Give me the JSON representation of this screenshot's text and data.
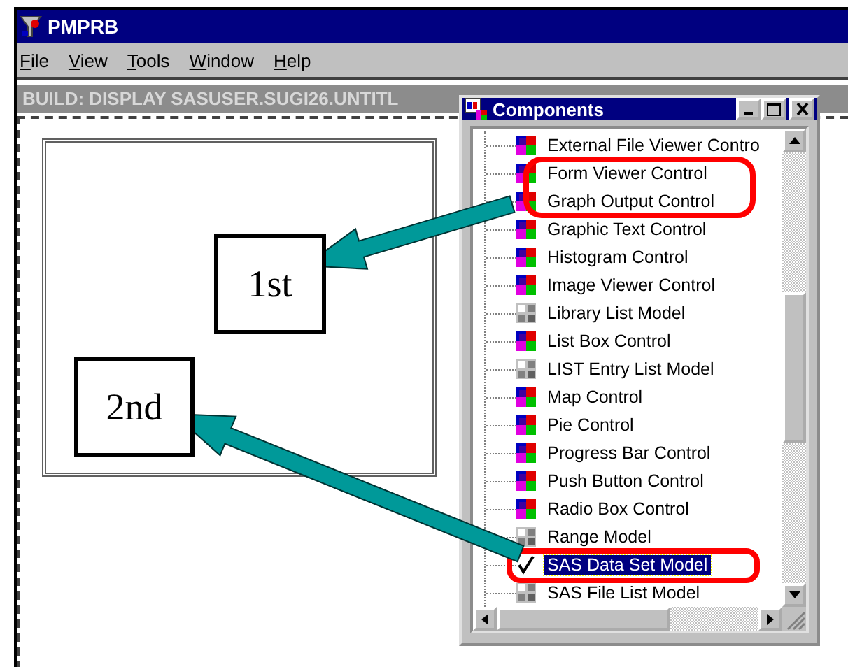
{
  "window": {
    "title": "PMPRB"
  },
  "menu": [
    {
      "label": "File"
    },
    {
      "label": "View"
    },
    {
      "label": "Tools"
    },
    {
      "label": "Window"
    },
    {
      "label": "Help"
    }
  ],
  "build_window": {
    "title": "BUILD: DISPLAY SASUSER.SUGI26.UNTITL"
  },
  "components": {
    "title": "Components",
    "items": [
      {
        "label": "External File Viewer Contro",
        "kind": "control",
        "selected": false
      },
      {
        "label": "Form Viewer Control",
        "kind": "control",
        "selected": false
      },
      {
        "label": "Graph Output Control",
        "kind": "control",
        "selected": false
      },
      {
        "label": "Graphic Text Control",
        "kind": "control",
        "selected": false
      },
      {
        "label": "Histogram Control",
        "kind": "control",
        "selected": false
      },
      {
        "label": "Image Viewer Control",
        "kind": "control",
        "selected": false
      },
      {
        "label": "Library List Model",
        "kind": "model",
        "selected": false
      },
      {
        "label": "List Box Control",
        "kind": "control",
        "selected": false
      },
      {
        "label": "LIST Entry List Model",
        "kind": "model",
        "selected": false
      },
      {
        "label": "Map Control",
        "kind": "control",
        "selected": false
      },
      {
        "label": "Pie Control",
        "kind": "control",
        "selected": false
      },
      {
        "label": "Progress Bar Control",
        "kind": "control",
        "selected": false
      },
      {
        "label": "Push Button Control",
        "kind": "control",
        "selected": false
      },
      {
        "label": "Radio Box Control",
        "kind": "control",
        "selected": false
      },
      {
        "label": "Range Model",
        "kind": "model",
        "selected": false
      },
      {
        "label": "SAS Data Set Model",
        "selected": true
      },
      {
        "label": "SAS File List Model",
        "kind": "model",
        "selected": false
      }
    ]
  },
  "callouts": [
    {
      "label": "1st"
    },
    {
      "label": "2nd"
    }
  ]
}
